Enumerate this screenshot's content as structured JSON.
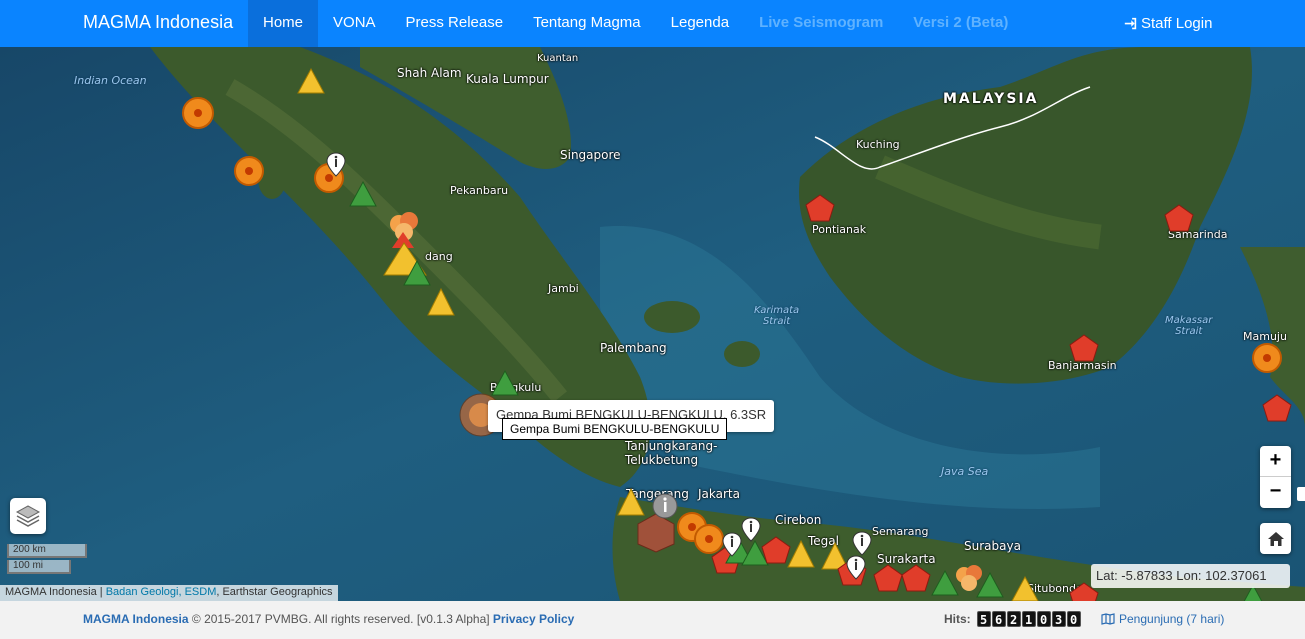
{
  "navbar": {
    "brand": "MAGMA Indonesia",
    "items": [
      {
        "label": "Home"
      },
      {
        "label": "VONA"
      },
      {
        "label": "Press Release"
      },
      {
        "label": "Tentang Magma"
      },
      {
        "label": "Legenda"
      },
      {
        "label": "Live Seismogram"
      },
      {
        "label": "Versi 2 (Beta)"
      }
    ],
    "staff_login": "Staff Login"
  },
  "map": {
    "places": {
      "indian_ocean": "Indian Ocean",
      "shah_alam": "Shah Alam",
      "kuala_lumpur": "Kuala Lumpur",
      "kuantan": "Kuantan",
      "malaysia": "MALAYSIA",
      "singapore": "Singapore",
      "kuching": "Kuching",
      "pekanbaru": "Pekanbaru",
      "padang": "dang",
      "pontianak": "Pontianak",
      "samarinda": "Samarinda",
      "jambi": "Jambi",
      "karimata": "Karimata\nStrait",
      "makassar": "Makassar\nStrait",
      "mamuju": "Mamuju",
      "palembang": "Palembang",
      "banjarmasin": "Banjarmasin",
      "bengkulu": "Bengkulu",
      "tanjungkarang": "Tanjungkarang-\nTelukbetung",
      "java_sea": "Java Sea",
      "tangerang": "Tangerang",
      "jakarta": "Jakarta",
      "cirebon": "Cirebon",
      "semarang": "Semarang",
      "tegal": "Tegal",
      "surakarta": "Surakarta",
      "surabaya": "Surabaya",
      "situbondo": "Situbondo"
    },
    "tooltip_popup": "Gempa Bumi BENGKULU-BENGKULU, 6.3SR",
    "tooltip_label": "Gempa Bumi BENGKULU-BENGKULU",
    "zoom_in": "+",
    "zoom_out": "−",
    "scale_km": "200 km",
    "scale_mi": "100 mi",
    "attribution_prefix": "MAGMA Indonesia | ",
    "attribution_link": "Badan Geologi, ESDM",
    "attribution_suffix": ", Earthstar Geographics",
    "latlon": "Lat: -5.87833 Lon: 102.37061",
    "colors": {
      "normal": "#3f9e3f",
      "waspada": "#f2c12e",
      "siaga": "#f08a1c",
      "eruption": "#e03d2a"
    }
  },
  "footer": {
    "brand": "MAGMA Indonesia",
    "copyright": "© 2015-2017 PVMBG. All rights reserved. [v0.1.3 Alpha]",
    "privacy": "Privacy Policy",
    "hits_label": "Hits:",
    "hits_digits": [
      "5",
      "6",
      "2",
      "1",
      "0",
      "3",
      "0"
    ],
    "visitors": "Pengunjung (7 hari)"
  }
}
